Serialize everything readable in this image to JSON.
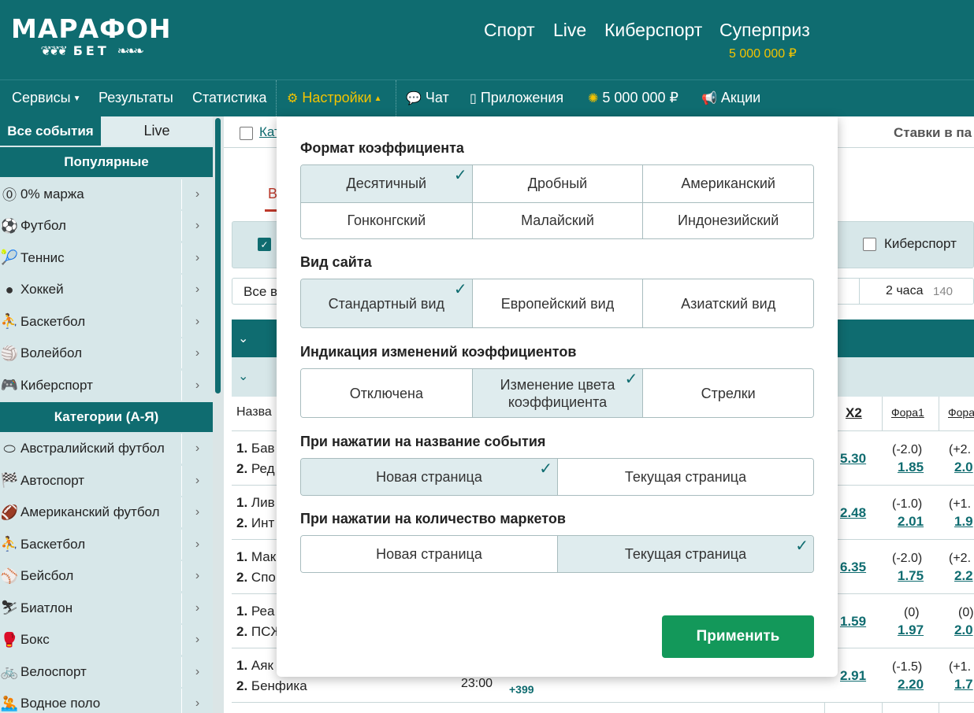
{
  "header": {
    "logo_main": "МАРАФОН",
    "logo_sub": "БЕТ",
    "nav": [
      "Спорт",
      "Live",
      "Киберспорт",
      "Суперприз"
    ],
    "superprize_amount": "5 000 000 ₽"
  },
  "menubar": {
    "services": "Сервисы",
    "results": "Результаты",
    "statistics": "Статистика",
    "settings": "Настройки",
    "chat": "Чат",
    "apps": "Приложения",
    "prize": "5 000 000 ₽",
    "promos": "Акции"
  },
  "sidebar": {
    "tab_all": "Все события",
    "tab_live": "Live",
    "popular_header": "Популярные",
    "popular": [
      {
        "label": "0% маржа",
        "icon": "zero-margin-icon"
      },
      {
        "label": "Футбол",
        "icon": "football-icon"
      },
      {
        "label": "Теннис",
        "icon": "tennis-icon"
      },
      {
        "label": "Хоккей",
        "icon": "hockey-icon"
      },
      {
        "label": "Баскетбол",
        "icon": "basketball-icon"
      },
      {
        "label": "Волейбол",
        "icon": "volleyball-icon"
      },
      {
        "label": "Киберспорт",
        "icon": "esports-icon"
      }
    ],
    "categories_header": "Категории (А-Я)",
    "categories": [
      {
        "label": "Австралийский футбол",
        "icon": "aussie-rules-icon"
      },
      {
        "label": "Автоспорт",
        "icon": "motorsport-icon"
      },
      {
        "label": "Американский футбол",
        "icon": "american-football-icon"
      },
      {
        "label": "Баскетбол",
        "icon": "basketball-icon"
      },
      {
        "label": "Бейсбол",
        "icon": "baseball-icon"
      },
      {
        "label": "Биатлон",
        "icon": "biathlon-icon"
      },
      {
        "label": "Бокс",
        "icon": "boxing-icon"
      },
      {
        "label": "Велоспорт",
        "icon": "cycling-icon"
      },
      {
        "label": "Водное поло",
        "icon": "water-polo-icon"
      }
    ]
  },
  "main": {
    "top_checkbox_label": "Кат",
    "top_right_text": "Ставки в па",
    "tab_label": "В",
    "filter_esports": "Киберспорт",
    "time_all": "Все в",
    "time_2h": "2 часа",
    "time_2h_count": "140",
    "col_name": "Назва",
    "col_x2": "X2",
    "col_fora1": "Фора1",
    "col_fora2": "Фора",
    "rows": [
      {
        "t1": "Бав",
        "t2": "Ред",
        "x2": "5.30",
        "h1": "(-2.0)",
        "o1": "1.85",
        "h2": "(+2.",
        "o2": "2.0"
      },
      {
        "t1": "Лив",
        "t2": "Инт",
        "x2": "2.48",
        "h1": "(-1.0)",
        "o1": "2.01",
        "h2": "(+1.",
        "o2": "1.9"
      },
      {
        "t1": "Мак",
        "t2": "Спо",
        "x2": "6.35",
        "h1": "(-2.0)",
        "o1": "1.75",
        "h2": "(+2.",
        "o2": "2.2"
      },
      {
        "t1": "Реа",
        "t2": "ПСЖ",
        "x2": "1.59",
        "h1": "(0)",
        "o1": "1.97",
        "h2": "(0)",
        "o2": "2.0"
      },
      {
        "t1": "Аяк",
        "t2": "Бенфика",
        "time": "23:00",
        "markets": "+399",
        "x2": "2.91",
        "h1": "(-1.5)",
        "o1": "2.20",
        "h2": "(+1.",
        "o2": "1.7"
      }
    ]
  },
  "popup": {
    "odds_format_title": "Формат коэффициента",
    "odds_formats": [
      "Десятичный",
      "Дробный",
      "Американский",
      "Гонконгский",
      "Малайский",
      "Индонезийский"
    ],
    "odds_format_selected": "Десятичный",
    "site_view_title": "Вид сайта",
    "site_views": [
      "Стандартный вид",
      "Европейский вид",
      "Азиатский вид"
    ],
    "site_view_selected": "Стандартный вид",
    "odds_change_title": "Индикация изменений коэффициентов",
    "odds_change_options": [
      "Отключена",
      "Изменение цвета коэффициента",
      "Стрелки"
    ],
    "odds_change_selected": "Изменение цвета коэффициента",
    "event_click_title": "При нажатии на название события",
    "event_click_options": [
      "Новая страница",
      "Текущая страница"
    ],
    "event_click_selected": "Новая страница",
    "markets_click_title": "При нажатии на количество маркетов",
    "markets_click_options": [
      "Новая страница",
      "Текущая страница"
    ],
    "markets_click_selected": "Текущая страница",
    "apply_label": "Применить"
  },
  "colors": {
    "brand_teal": "#0f6c70",
    "accent_yellow": "#f3c300",
    "apply_green": "#13985a",
    "selected_bg": "#dfecee"
  }
}
